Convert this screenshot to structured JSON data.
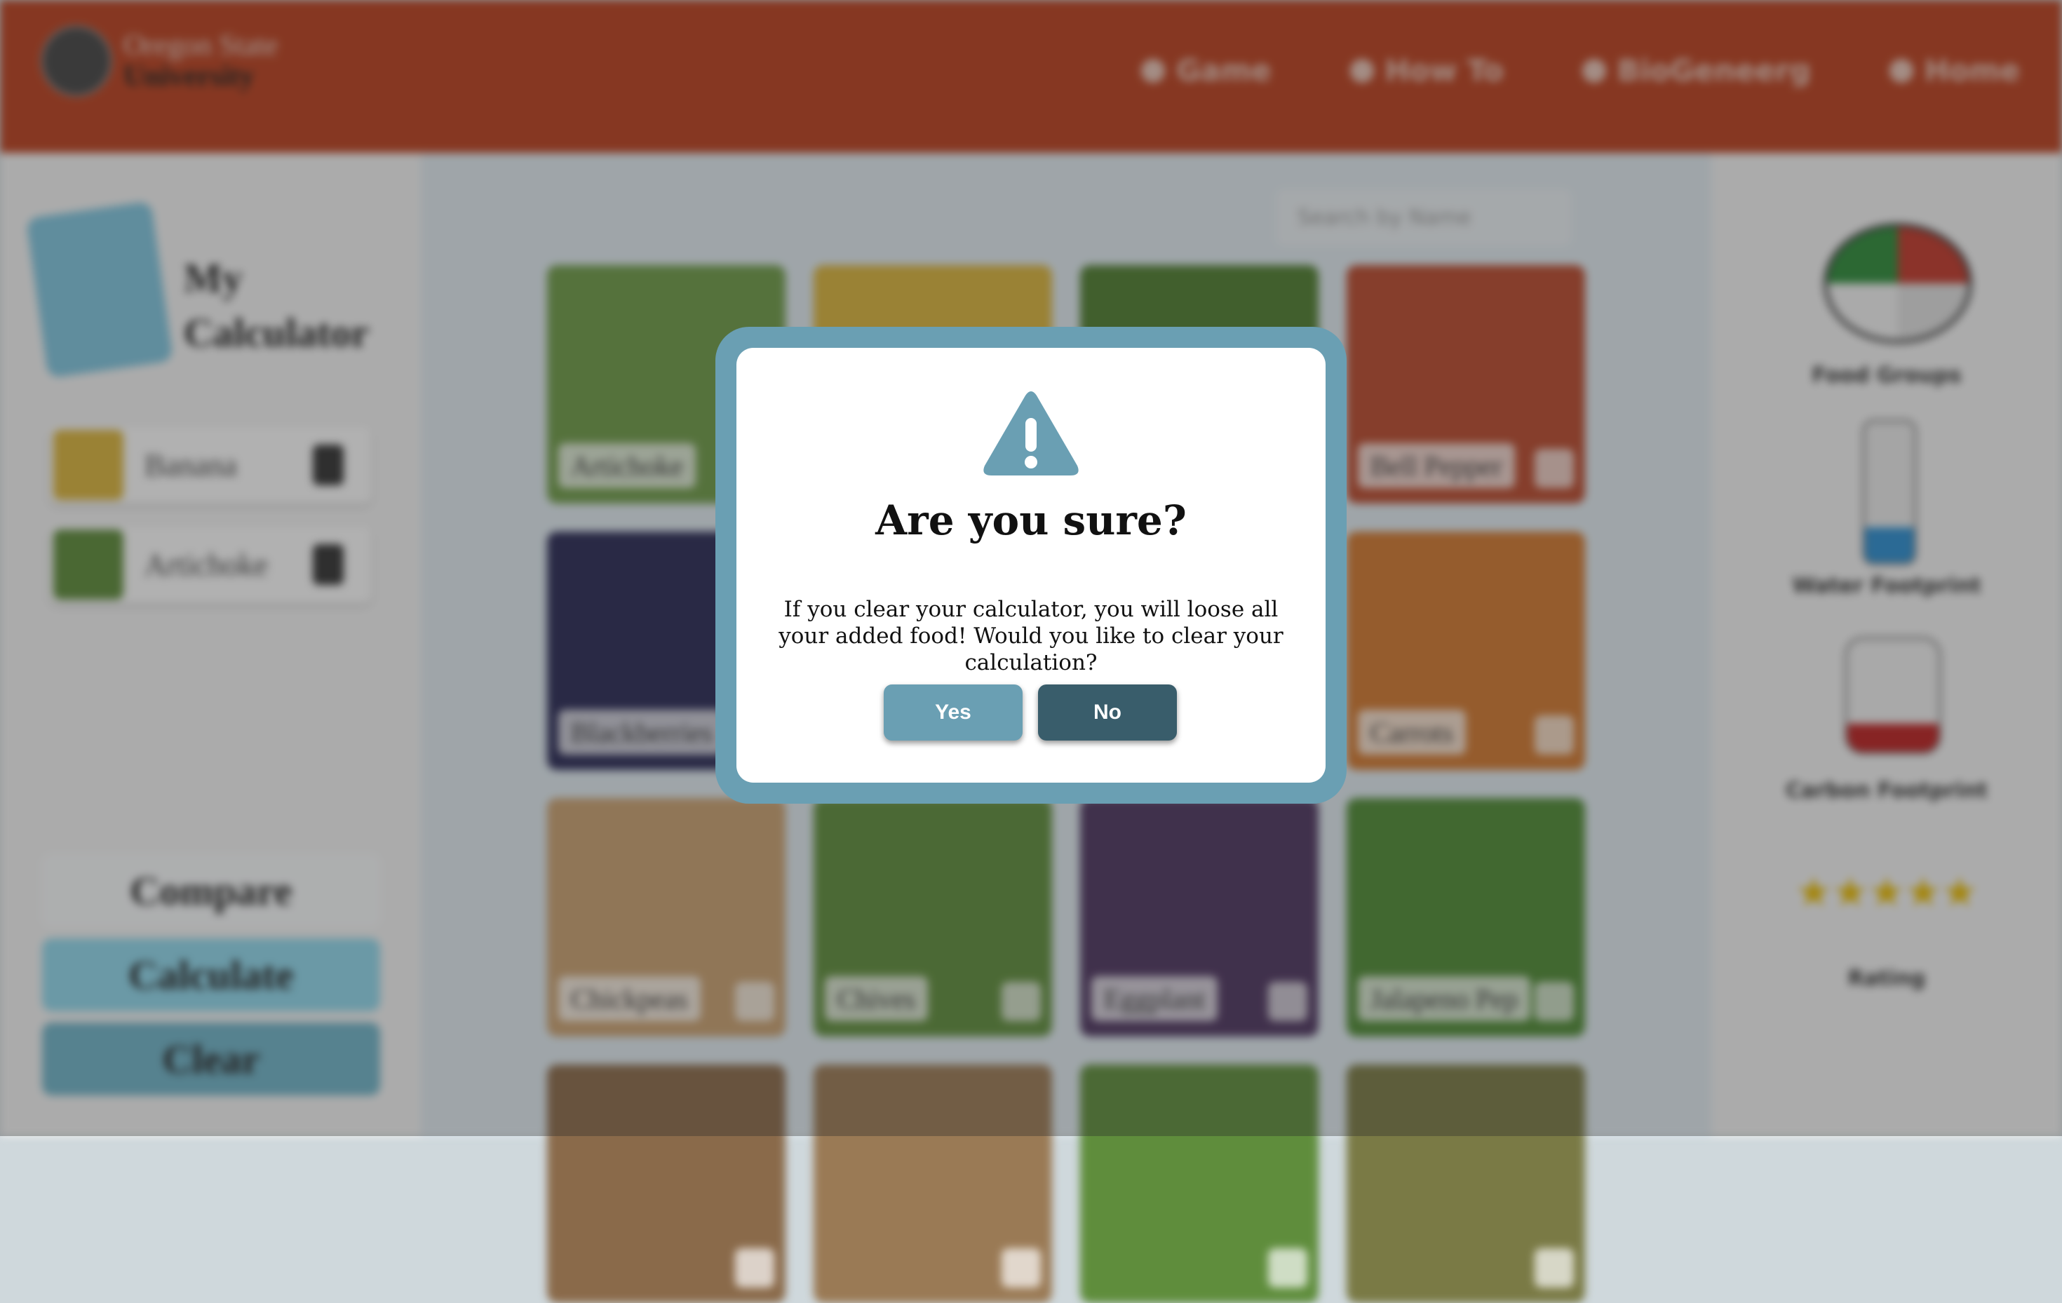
{
  "header": {
    "logo_line1": "Oregon State",
    "logo_line2": "University",
    "nav": [
      {
        "label": "Game",
        "icon": "gamepad-icon"
      },
      {
        "label": "How To",
        "icon": "question-icon"
      },
      {
        "label": "BioGeneerg",
        "icon": "book-icon"
      },
      {
        "label": "Home",
        "icon": "home-icon"
      }
    ]
  },
  "sidebar": {
    "title": "My Calculator",
    "items": [
      {
        "name": "Banana",
        "color": "#d8b23c"
      },
      {
        "name": "Artichoke",
        "color": "#5d8a3a"
      }
    ],
    "buttons": {
      "compare": "Compare",
      "calculate": "Calculate",
      "clear": "Clear"
    }
  },
  "main": {
    "search_placeholder": "Search by Name",
    "tiles": [
      {
        "label": "Artichoke",
        "color": "#6e9a48"
      },
      {
        "label": "",
        "color": "#d8b23c"
      },
      {
        "label": "",
        "color": "#4f7d30"
      },
      {
        "label": "Bell Pepper",
        "color": "#b84a2e"
      },
      {
        "label": "Blackberries",
        "color": "#2a2a55"
      },
      {
        "label": "",
        "color": "#5a7a3a"
      },
      {
        "label": "",
        "color": "#6a8a3a"
      },
      {
        "label": "Carrots",
        "color": "#d07830"
      },
      {
        "label": "Chickpeas",
        "color": "#c8a070"
      },
      {
        "label": "Chives",
        "color": "#5f8d3c"
      },
      {
        "label": "Eggplant",
        "color": "#4e3660"
      },
      {
        "label": "Jalapeno Pep",
        "color": "#4f8a35"
      },
      {
        "label": "",
        "color": "#8a6a4a"
      },
      {
        "label": "",
        "color": "#9a7a55"
      },
      {
        "label": "",
        "color": "#5f8d3c"
      },
      {
        "label": "",
        "color": "#7a7a45"
      }
    ]
  },
  "right_panel": {
    "food_groups": "Food Groups",
    "water": "Water Footprint",
    "carbon": "Carbon Footprint",
    "rating_label": "Rating",
    "stars": "★★★★★"
  },
  "modal": {
    "title": "Are you sure?",
    "message": "If you clear your calculator, you will loose all your added food! Would you like to clear your calculation?",
    "yes_label": "Yes",
    "no_label": "No",
    "accent": "#6a9fb3",
    "no_color": "#395d6b"
  }
}
